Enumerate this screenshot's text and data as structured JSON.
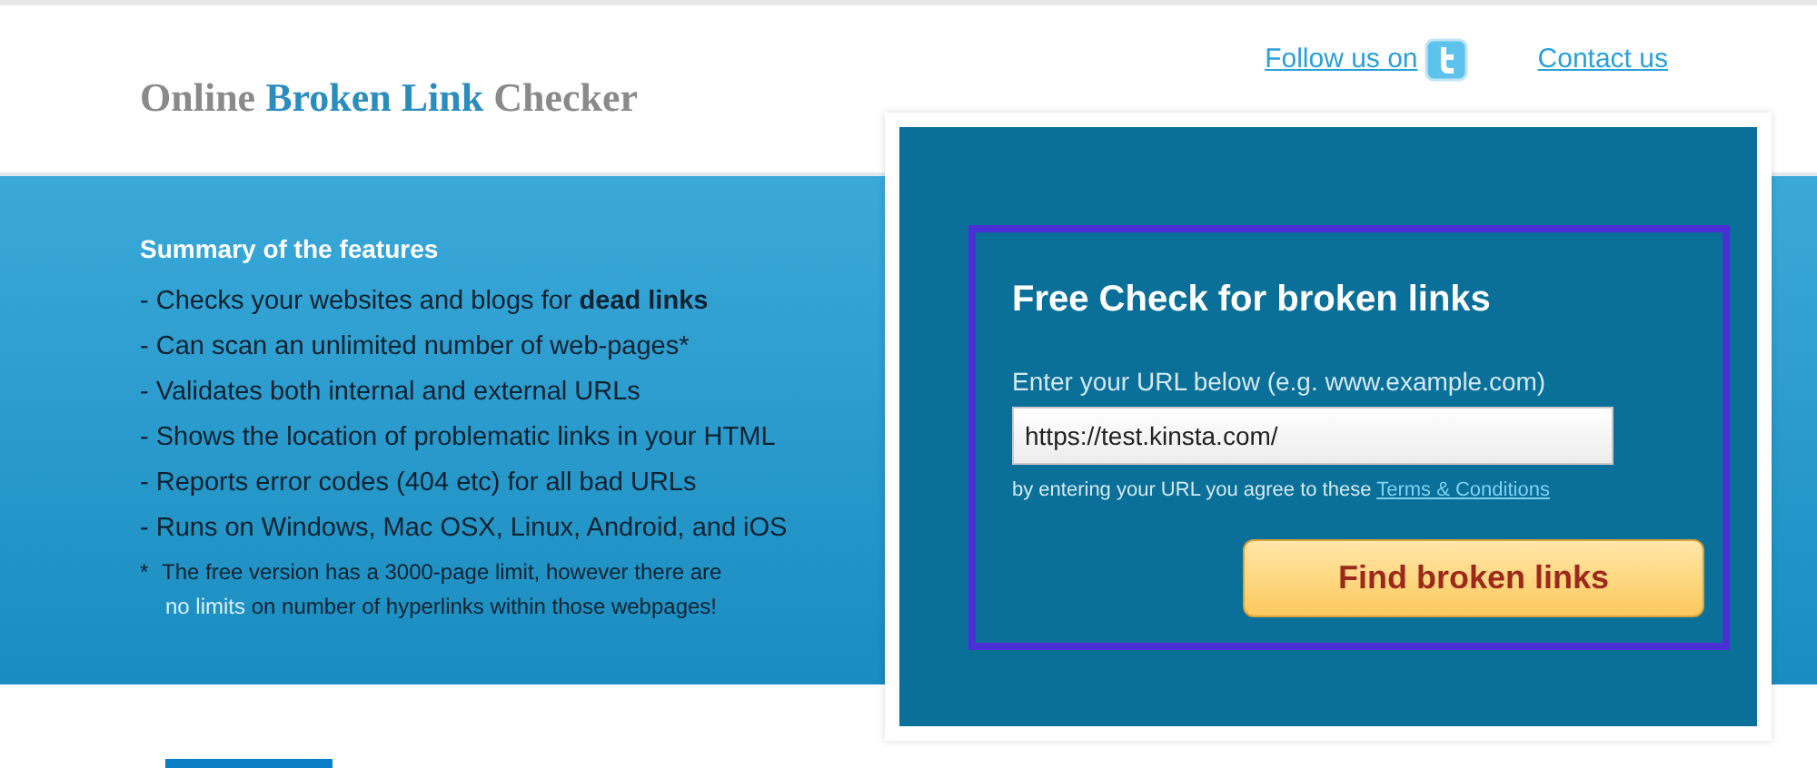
{
  "header": {
    "logo": [
      {
        "text": "Online",
        "accent": false
      },
      {
        "text": "Broken Link",
        "accent": true
      },
      {
        "text": "Checker",
        "accent": false
      }
    ],
    "links": [
      {
        "label": "Follow us on",
        "kind": "twitter"
      },
      {
        "label": "Contact us",
        "kind": "plain"
      }
    ]
  },
  "features": {
    "title": "Summary of the features",
    "items": [
      "- Checks your websites and blogs for **dead links**",
      "- Can scan an unlimited number of web-pages*",
      "- Validates both internal and external URLs",
      "- Shows the location of problematic links in your HTML",
      "- Reports error codes (404 etc) for all bad URLs",
      "- Runs on Windows, Mac OSX, Linux, Android, and iOS"
    ],
    "footnote": {
      "mark": "*",
      "line1": "The free version has a 3000-page limit, however there are",
      "highlight": "no limits",
      "rest": "on number of hyperlinks within those webpages!"
    }
  },
  "check_form": {
    "title": "Free Check for broken links",
    "label": "Enter your URL below (e.g. www.example.com)",
    "url": "https://test.kinsta.com/",
    "agree_text": "by entering your URL you agree to these",
    "terms_link": "Terms & Conditions",
    "button": "Find broken links",
    "highlighted": true
  }
}
